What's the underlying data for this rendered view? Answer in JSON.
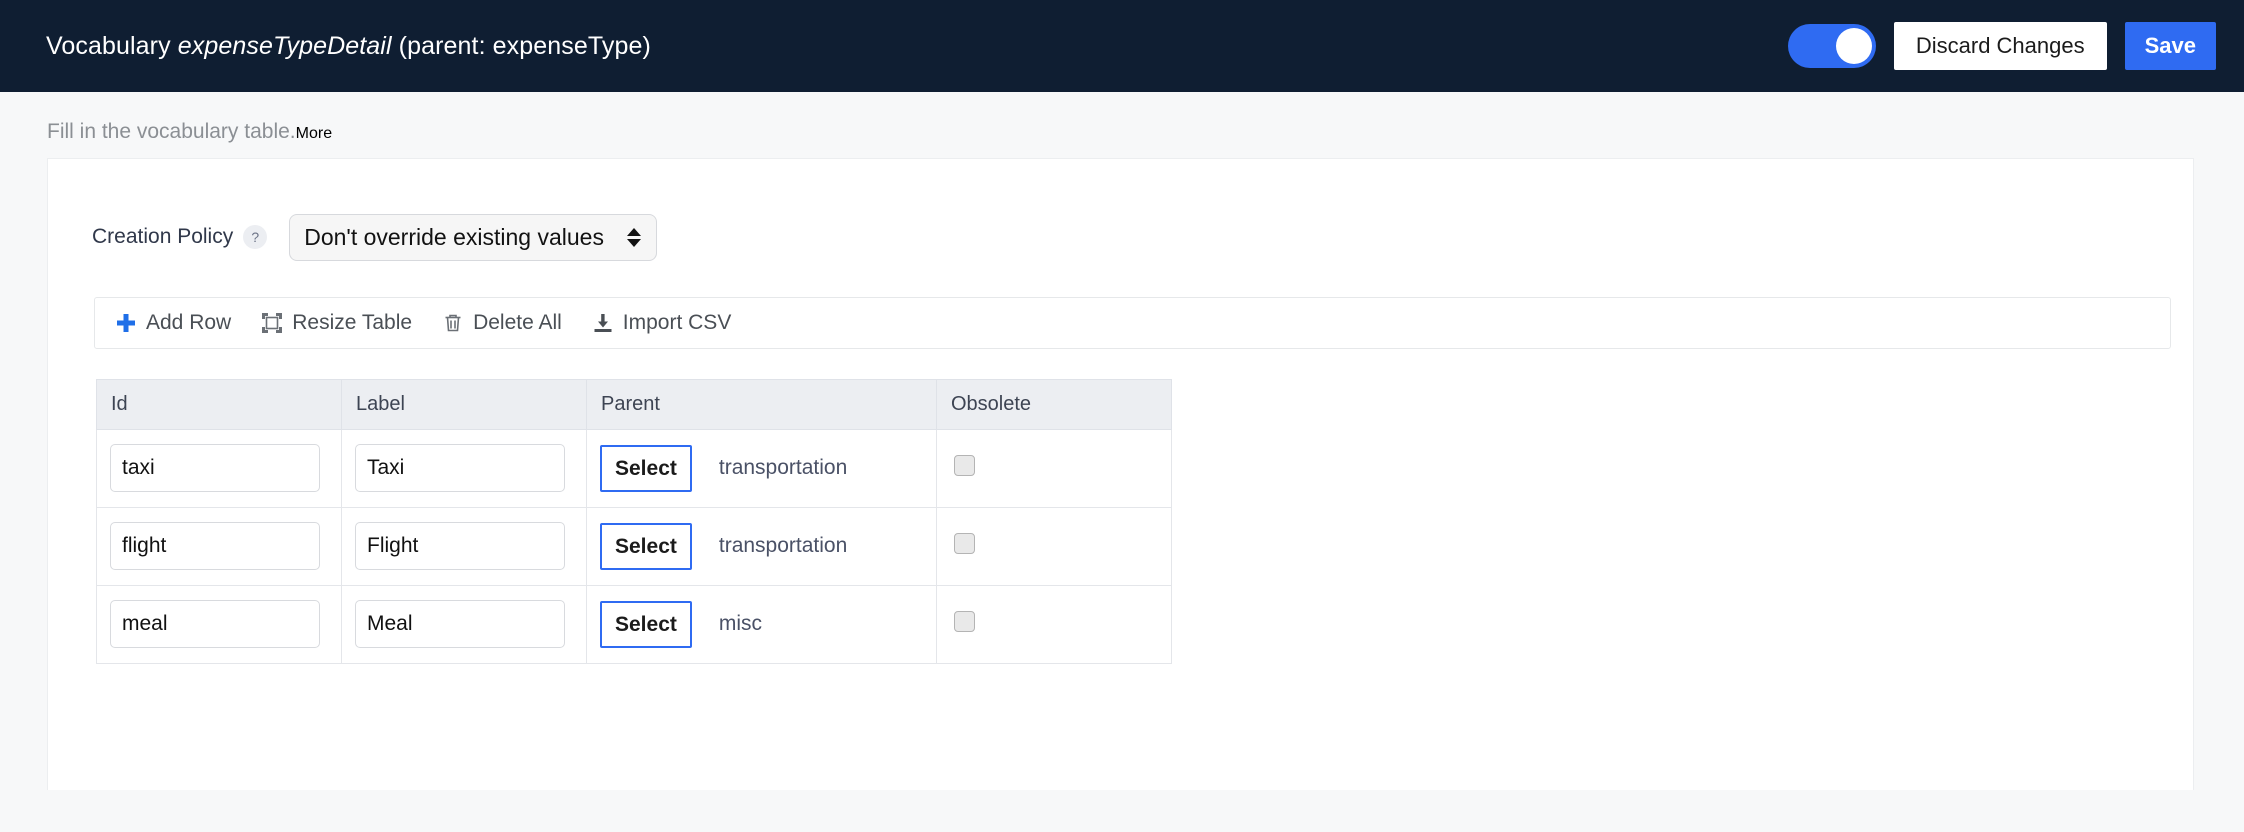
{
  "header": {
    "title_prefix": "Vocabulary",
    "title_emphasis": "expenseTypeDetail",
    "title_suffix": "(parent: expenseType)",
    "toggle_on": true,
    "discard_label": "Discard Changes",
    "save_label": "Save",
    "accent_color": "#2f6bf2",
    "bar_color": "#0f1e32"
  },
  "subtitle": {
    "text": "Fill in the vocabulary table.",
    "more_label": "More"
  },
  "policy": {
    "label": "Creation Policy",
    "help_glyph": "?",
    "selected": "Don't override existing values",
    "options": [
      "Don't override existing values"
    ]
  },
  "toolbar": {
    "add_row": "Add Row",
    "resize_table": "Resize Table",
    "delete_all": "Delete All",
    "import_csv": "Import CSV"
  },
  "table": {
    "columns": [
      "Id",
      "Label",
      "Parent",
      "Obsolete"
    ],
    "select_button_label": "Select",
    "rows": [
      {
        "id": "taxi",
        "label": "Taxi",
        "parent": "transportation",
        "obsolete": false
      },
      {
        "id": "flight",
        "label": "Flight",
        "parent": "transportation",
        "obsolete": false
      },
      {
        "id": "meal",
        "label": "Meal",
        "parent": "misc",
        "obsolete": false
      }
    ]
  }
}
